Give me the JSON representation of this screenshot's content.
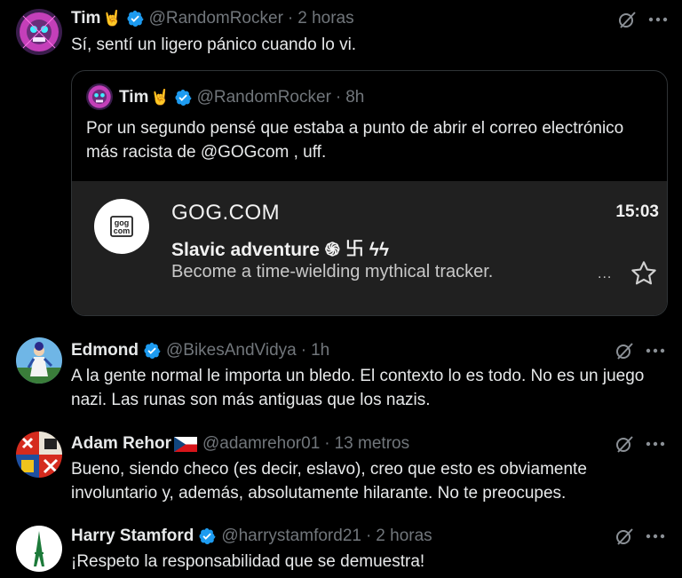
{
  "replies": [
    {
      "name": "Tim",
      "name_emoji": "🤘",
      "handle": "@RandomRocker",
      "time": "2 horas",
      "text": "Sí, sentí un ligero pánico cuando lo vi.",
      "quote": {
        "name": "Tim",
        "name_emoji": "🤘",
        "handle": "@RandomRocker",
        "time": "8h",
        "text": "Por un segundo pensé que estaba a punto de abrir el correo electrónico más racista de @GOGcom , uff.",
        "notification": {
          "app_name": "GOG.COM",
          "time": "15:03",
          "title": "Slavic adventure ֍ ࿕ ϟϟ",
          "body": "Become a time-wielding mythical tracker.",
          "dots": "...",
          "logo_text": [
            "gog",
            "com"
          ]
        }
      }
    },
    {
      "name": "Edmond",
      "handle": "@BikesAndVidya",
      "time": "1h",
      "text": "A la gente normal le importa un bledo. El contexto lo es todo. No es un juego nazi. Las runas son más antiguas que los nazis."
    },
    {
      "name": "Adam Rehor",
      "name_emoji": "🇨🇿",
      "handle": "@adamrehor01",
      "time": "13 metros",
      "text": "Bueno, siendo checo (es decir, eslavo), creo que esto es obviamente involuntario y, además, absolutamente hilarante. No te preocupes."
    },
    {
      "name": "Harry Stamford",
      "handle": "@harrystamford21",
      "time": "2 horas",
      "text": "¡Respeto la responsabilidad que se demuestra!"
    }
  ],
  "separator": "·",
  "icons": {
    "verified": "verified-badge-icon",
    "grok": "grok-icon",
    "more": "more-icon",
    "star": "star-icon"
  },
  "colors": {
    "background": "#000000",
    "text": "#e7e9ea",
    "secondary": "#71767b",
    "verified": "#1d9bf0",
    "notification_bg": "#202020"
  }
}
